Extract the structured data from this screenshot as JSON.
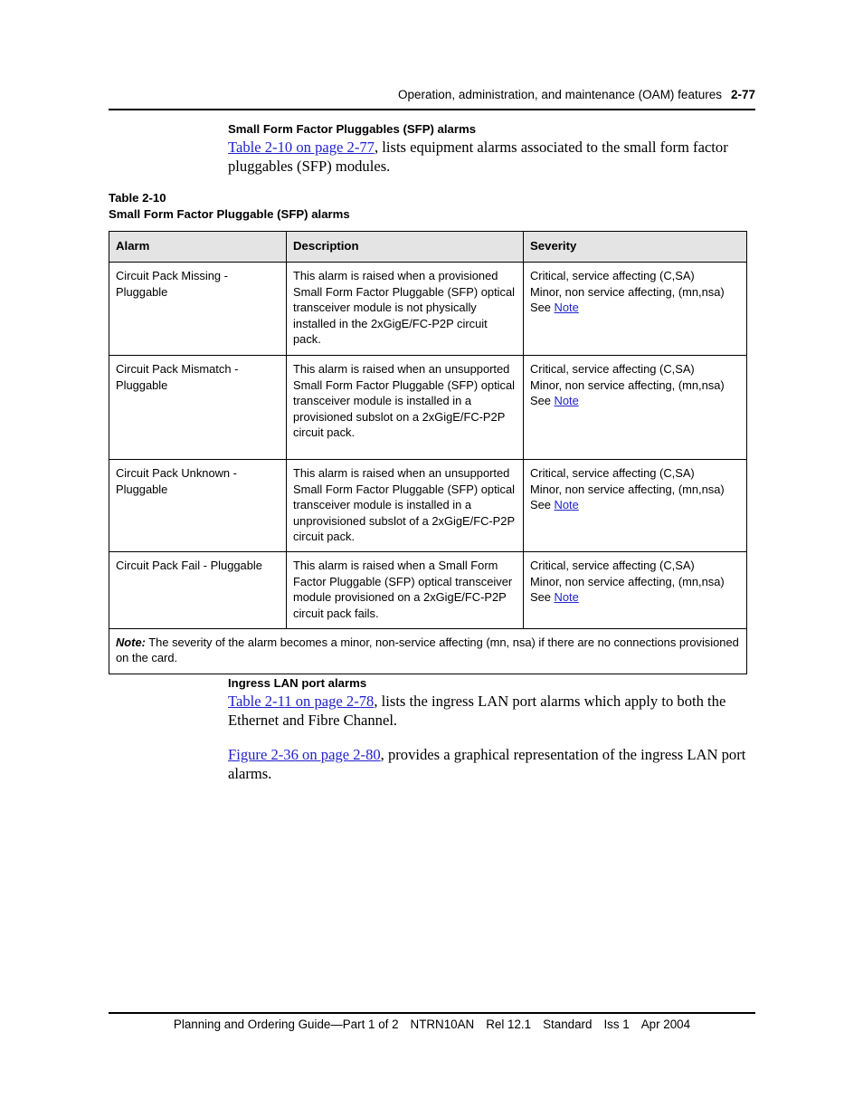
{
  "header": {
    "title": "Operation, administration, and maintenance (OAM) features",
    "page_number": "2-77"
  },
  "section": {
    "heading": "Small Form Factor Pluggables (SFP) alarms",
    "intro_link": "Table 2-10 on page 2-77",
    "intro_rest": ", lists equipment alarms associated to the small form factor pluggables (SFP) modules."
  },
  "table": {
    "caption_number": "Table 2-10",
    "caption_title": "Small Form Factor Pluggable (SFP) alarms",
    "columns": [
      "Alarm",
      "Description",
      "Severity"
    ],
    "rows": [
      {
        "alarm": "Circuit Pack Missing - Pluggable",
        "description": "This alarm is raised when a provisioned Small Form Factor Pluggable (SFP) optical transceiver module is not physically installed in the 2xGigE/FC-P2P circuit pack.",
        "severity_line1": "Critical, service affecting (C,SA)",
        "severity_line2": "Minor, non service affecting, (mn,nsa)",
        "severity_see": "See ",
        "severity_link": "Note"
      },
      {
        "alarm": "Circuit Pack Mismatch - Pluggable",
        "description": "This alarm is raised when an unsupported Small Form Factor Pluggable (SFP) optical transceiver module is installed in a provisioned subslot on a 2xGigE/FC-P2P circuit pack.",
        "severity_line1": "Critical, service affecting (C,SA)",
        "severity_line2": "Minor, non service affecting, (mn,nsa)",
        "severity_see": "See ",
        "severity_link": "Note"
      },
      {
        "alarm": "Circuit Pack Unknown - Pluggable",
        "description": "This alarm is raised when an unsupported Small Form Factor Pluggable (SFP) optical transceiver module is installed in a unprovisioned subslot of a 2xGigE/FC-P2P circuit pack.",
        "severity_line1": "Critical, service affecting (C,SA)",
        "severity_line2": "Minor, non service affecting, (mn,nsa)",
        "severity_see": "See ",
        "severity_link": "Note"
      },
      {
        "alarm": "Circuit Pack Fail - Pluggable",
        "description": "This alarm is raised when a Small Form Factor Pluggable (SFP) optical transceiver module provisioned on a 2xGigE/FC-P2P circuit pack fails.",
        "severity_line1": "Critical, service affecting (C,SA)",
        "severity_line2": "Minor, non service affecting, (mn,nsa)",
        "severity_see": "See ",
        "severity_link": "Note"
      }
    ],
    "note_label": "Note:",
    "note_text": "  The severity of the alarm becomes a minor, non-service affecting (mn, nsa) if there are no connections provisioned on the card."
  },
  "section2": {
    "heading": "Ingress LAN port alarms",
    "para1_link": "Table 2-11 on page 2-78",
    "para1_rest": ", lists the ingress LAN port alarms which apply to both the Ethernet and Fibre Channel.",
    "para2_link": "Figure 2-36 on page 2-80",
    "para2_rest": ", provides a graphical representation of the ingress LAN port alarms."
  },
  "footer": {
    "guide": "Planning and Ordering Guide—Part 1 of 2",
    "doc_number": "NTRN10AN",
    "release": "Rel 12.1",
    "status": "Standard",
    "issue": "Iss 1",
    "date": "Apr 2004"
  },
  "colors": {
    "link": "#2222cc",
    "table_header_bg": "#e4e4e4",
    "rule": "#000000",
    "text": "#000000"
  }
}
